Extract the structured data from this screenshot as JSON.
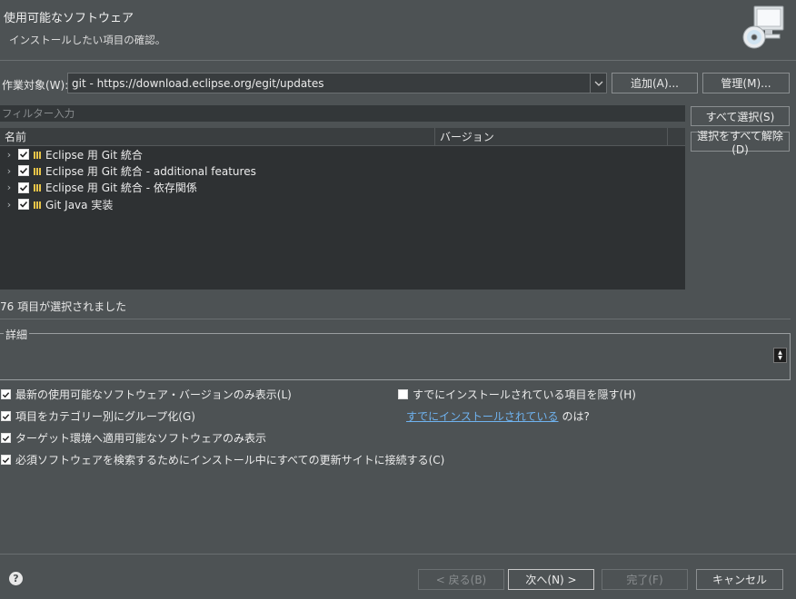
{
  "header": {
    "title": "使用可能なソフトウェア",
    "subtitle": "インストールしたい項目の確認。",
    "icon": "install-software-icon"
  },
  "work_with": {
    "label": "作業対象(W):",
    "value": "git - https://download.eclipse.org/egit/updates",
    "add_label": "追加(A)...",
    "manage_label": "管理(M)..."
  },
  "filter": {
    "placeholder": "フィルター入力"
  },
  "side_buttons": {
    "select_all": "すべて選択(S)",
    "deselect_all": "選択をすべて解除(D)"
  },
  "table": {
    "columns": [
      "名前",
      "バージョン"
    ],
    "rows": [
      {
        "label": "Eclipse 用 Git 統合",
        "checked": true
      },
      {
        "label": "Eclipse 用 Git 統合 - additional features",
        "checked": true
      },
      {
        "label": "Eclipse 用 Git 統合 - 依存関係",
        "checked": true
      },
      {
        "label": "Git Java 実装",
        "checked": true
      }
    ]
  },
  "status": "76 項目が選択されました",
  "details": {
    "legend": "詳細"
  },
  "options": {
    "latest_only": {
      "label": "最新の使用可能なソフトウェア・バージョンのみ表示(L)",
      "checked": true
    },
    "group_by_category": {
      "label": "項目をカテゴリー別にグループ化(G)",
      "checked": true
    },
    "target_only": {
      "label": "ターゲット環境へ適用可能なソフトウェアのみ表示",
      "checked": true
    },
    "contact_all_sites": {
      "label": "必須ソフトウェアを検索するためにインストール中にすべての更新サイトに接続する(C)",
      "checked": true
    },
    "hide_installed": {
      "label": "すでにインストールされている項目を隠す(H)",
      "checked": false
    },
    "already_installed_link": "すでにインストールされている",
    "already_installed_suffix": "のは?"
  },
  "footer": {
    "back": "< 戻る(B)",
    "next": "次へ(N) >",
    "finish": "完了(F)",
    "cancel": "キャンセル"
  },
  "colors": {
    "background": "#4d5254",
    "table_bg": "#2e3133",
    "link": "#6fb3f0",
    "feature_icon": "#e8c448"
  }
}
